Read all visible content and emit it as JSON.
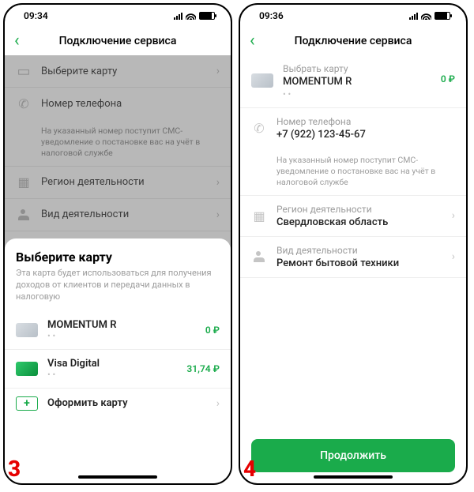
{
  "phones": {
    "left": {
      "time": "09:34",
      "title": "Подключение сервиса",
      "rows": {
        "card": "Выберите карту",
        "phone": "Номер телефона",
        "region": "Регион деятельности",
        "activity": "Вид деятельности"
      },
      "note": "На указанный номер поступит СМС-уведомление о постановке вас на учёт в налоговой службе",
      "sheet": {
        "title": "Выберите карту",
        "desc": "Эта карта будет использоваться для получения доходов от клиентов и передачи данных в налоговую",
        "cards": [
          {
            "name": "MOMENTUM R",
            "mask": "• •",
            "balance": "0 ₽"
          },
          {
            "name": "Visa Digital",
            "mask": "• •",
            "balance": "31,74 ₽"
          }
        ],
        "add": "Оформить карту"
      },
      "step": "3"
    },
    "right": {
      "time": "09:36",
      "title": "Подключение сервиса",
      "card": {
        "label": "Выбрать карту",
        "name": "MOMENTUM R",
        "mask": "• •",
        "balance": "0 ₽"
      },
      "phone": {
        "label": "Номер телефона",
        "value": "+7 (922) 123-45-67"
      },
      "note": "На указанный номер поступит СМС-уведомление о постановке вас на учёт в налоговой службе",
      "region": {
        "label": "Регион деятельности",
        "value": "Свердловская область"
      },
      "activity": {
        "label": "Вид деятельности",
        "value": "Ремонт бытовой техники"
      },
      "cta": "Продолжить",
      "step": "4"
    }
  }
}
